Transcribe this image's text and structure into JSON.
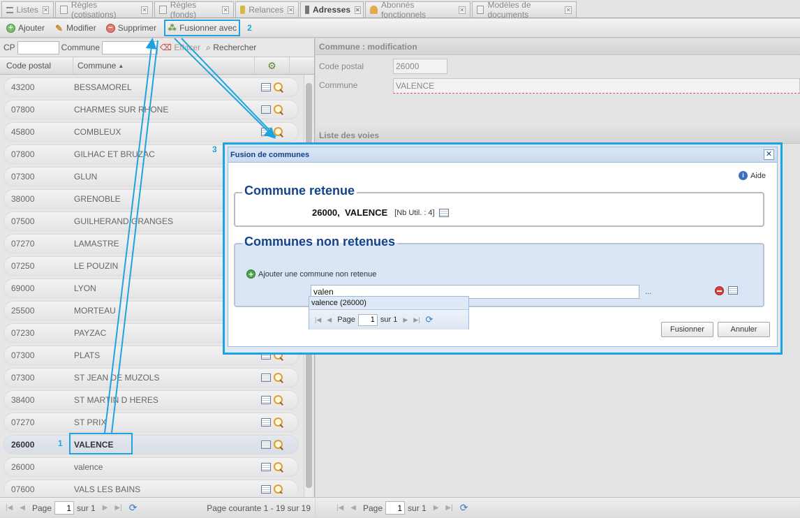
{
  "tabs": [
    {
      "label": "Listes",
      "icon": "list-icon"
    },
    {
      "label": "Règles (cotisations)",
      "icon": "rules-icon"
    },
    {
      "label": "Règles (fonds)",
      "icon": "rules-fonds-icon"
    },
    {
      "label": "Relances",
      "icon": "relances-icon"
    },
    {
      "label": "Adresses",
      "icon": "addresses-icon",
      "active": true
    },
    {
      "label": "Abonnés fonctionnels",
      "icon": "users-icon"
    },
    {
      "label": "Modèles de documents",
      "icon": "documents-icon"
    }
  ],
  "toolbar": {
    "add": "Ajouter",
    "edit": "Modifier",
    "delete": "Supprimer",
    "merge": "Fusionner avec"
  },
  "filters": {
    "cp_label": "CP",
    "commune_label": "Commune",
    "clear": "Effacer",
    "search": "Rechercher"
  },
  "grid": {
    "col_cp": "Code postal",
    "col_commune": "Commune",
    "rows": [
      {
        "cp": "43200",
        "commune": "BESSAMOREL"
      },
      {
        "cp": "07800",
        "commune": "CHARMES SUR RHONE"
      },
      {
        "cp": "45800",
        "commune": "COMBLEUX"
      },
      {
        "cp": "07800",
        "commune": "GILHAC ET BRUZAC"
      },
      {
        "cp": "07300",
        "commune": "GLUN"
      },
      {
        "cp": "38000",
        "commune": "GRENOBLE"
      },
      {
        "cp": "07500",
        "commune": "GUILHERAND GRANGES"
      },
      {
        "cp": "07270",
        "commune": "LAMASTRE"
      },
      {
        "cp": "07250",
        "commune": "LE POUZIN"
      },
      {
        "cp": "69000",
        "commune": "LYON"
      },
      {
        "cp": "25500",
        "commune": "MORTEAU"
      },
      {
        "cp": "07230",
        "commune": "PAYZAC"
      },
      {
        "cp": "07300",
        "commune": "PLATS"
      },
      {
        "cp": "07300",
        "commune": "ST JEAN DE MUZOLS"
      },
      {
        "cp": "38400",
        "commune": "ST MARTIN D HERES"
      },
      {
        "cp": "07270",
        "commune": "ST PRIX"
      },
      {
        "cp": "26000",
        "commune": "VALENCE",
        "selected": true
      },
      {
        "cp": "26000",
        "commune": "valence"
      },
      {
        "cp": "07600",
        "commune": "VALS LES BAINS"
      }
    ]
  },
  "pager_left": {
    "page_label": "Page",
    "page_value": "1",
    "of_label": "sur 1",
    "status": "Page courante 1 - 19 sur 19"
  },
  "detail": {
    "title": "Commune : modification",
    "cp_label": "Code postal",
    "cp_value": "26000",
    "commune_label": "Commune",
    "commune_value": "VALENCE",
    "voies_title": "Liste des voies",
    "page_label": "Page",
    "page_value": "1",
    "of_label": "sur 1"
  },
  "dialog": {
    "title": "Fusion de communes",
    "help": "Aide",
    "retained_legend": "Commune retenue",
    "retained_value": "26000,  VALENCE",
    "retained_nb": "[Nb Util. : 4]",
    "non_retained_legend": "Communes non retenues",
    "add_non_retained": "Ajouter une commune non retenue",
    "search_value": "valen",
    "dots": "...",
    "suggestion": "valence (26000)",
    "dd_page_label": "Page",
    "dd_page_value": "1",
    "dd_of_label": "sur 1",
    "merge_button": "Fusionner",
    "cancel_button": "Annuler"
  },
  "annotations": {
    "step1": "1",
    "step2": "2",
    "step3": "3"
  },
  "colors": {
    "annotation": "#1fa3e0",
    "dialog_title": "#15428b"
  }
}
